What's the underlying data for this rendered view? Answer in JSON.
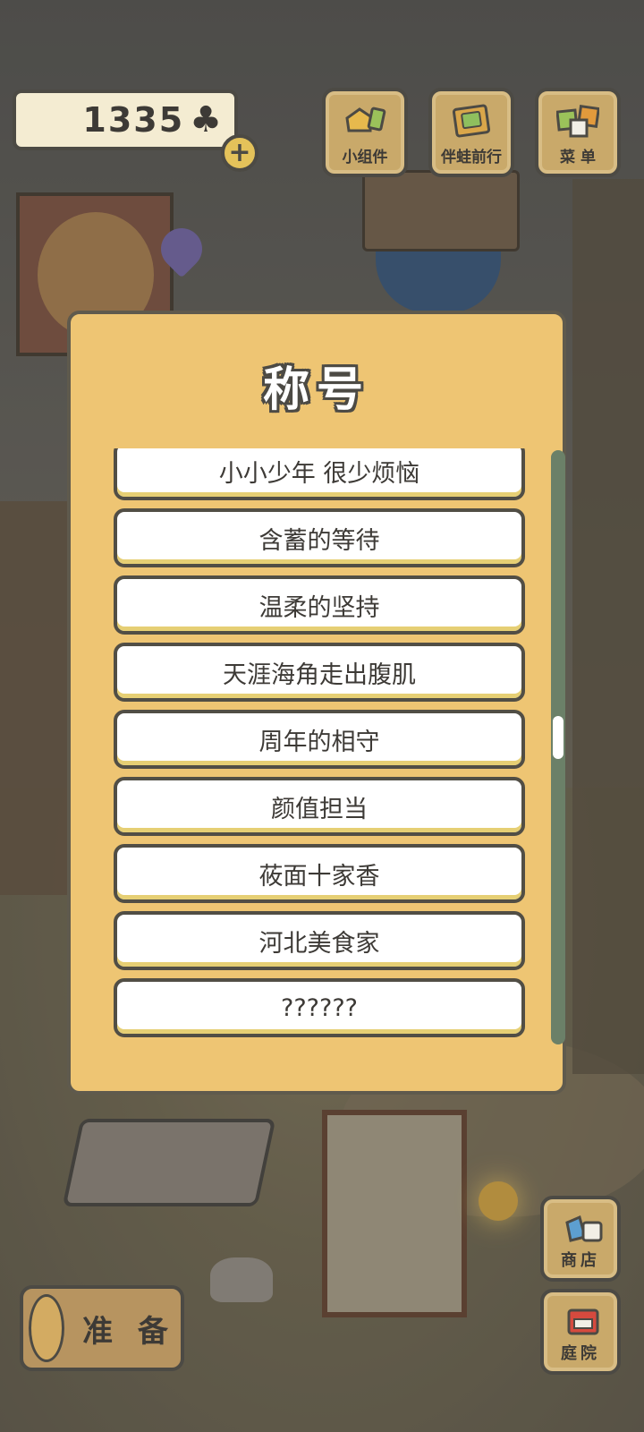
{
  "hud": {
    "clover_count": "1335",
    "clover_icon": "clover-icon",
    "add_label": "+",
    "buttons": [
      {
        "id": "widgets",
        "label": "小组件",
        "icon": "widgets-icon"
      },
      {
        "id": "frog",
        "label": "伴蛙前行",
        "icon": "notebook-icon"
      },
      {
        "id": "menu",
        "label": "菜 单",
        "icon": "cards-icon"
      }
    ]
  },
  "dialog": {
    "title": "称号",
    "items": [
      "小小少年 很少烦恼",
      "含蓄的等待",
      "温柔的坚持",
      "天涯海角走出腹肌",
      "周年的相守",
      "颜值担当",
      "莜面十家香",
      "河北美食家",
      "??????"
    ]
  },
  "bottom": {
    "prepare_label": "准 备",
    "shop_label": "商店",
    "garden_label": "庭院"
  },
  "colors": {
    "dialog_bg": "#eec573",
    "outline": "#4c4a44",
    "scroll_track": "#6b8068",
    "button_wood": "#c9a96a"
  }
}
